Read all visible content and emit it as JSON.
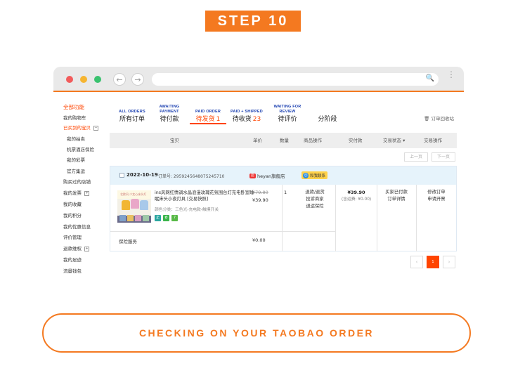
{
  "step_label": "STEP 10",
  "caption": "CHECKING ON YOUR TAOBAO ORDER",
  "browser": {
    "back_glyph": "←",
    "forward_glyph": "→",
    "search_glyph": "🔍",
    "menu_glyph": "⋮"
  },
  "sidebar": {
    "items": [
      {
        "label": "全部功能",
        "kind": "head"
      },
      {
        "label": "我的购物车",
        "kind": "item"
      },
      {
        "label": "已买到的宝贝",
        "kind": "active",
        "toggle": "−"
      },
      {
        "label": "我的拍卖",
        "kind": "sub"
      },
      {
        "label": "机票酒店保险",
        "kind": "sub"
      },
      {
        "label": "我的彩票",
        "kind": "sub"
      },
      {
        "label": "官方集运",
        "kind": "sub"
      },
      {
        "label": "购买过的店铺",
        "kind": "item"
      },
      {
        "label": "我的发票",
        "kind": "item",
        "toggle": "+"
      },
      {
        "label": "我的收藏",
        "kind": "item"
      },
      {
        "label": "我的积分",
        "kind": "item"
      },
      {
        "label": "我的优惠信息",
        "kind": "item"
      },
      {
        "label": "评价管理",
        "kind": "item"
      },
      {
        "label": "退款维权",
        "kind": "item",
        "toggle": "+"
      },
      {
        "label": "我的足迹",
        "kind": "item"
      },
      {
        "label": "流量钱包",
        "kind": "item"
      }
    ]
  },
  "tabs": [
    {
      "en": "ALL ORDERS",
      "cn": "所有订单",
      "count": ""
    },
    {
      "en": "AWAITING PAYMENT",
      "cn": "待付款",
      "count": ""
    },
    {
      "en": "PAID ORDER",
      "cn": "待发货",
      "count": "1",
      "active": true
    },
    {
      "en": "PAID + SHIPPED",
      "cn": "待收货",
      "count": "23"
    },
    {
      "en": "WAITING FOR REVIEW",
      "cn": "待评价",
      "count": ""
    },
    {
      "en": "",
      "cn": "分阶段",
      "count": ""
    }
  ],
  "recycle_bin": "🗑 订单回收站",
  "table_headers": [
    "宝贝",
    "单价",
    "数量",
    "商品操作",
    "实付款",
    "交易状态 ▾",
    "交易操作"
  ],
  "pager_top": {
    "prev": "上一页",
    "next": "下一页"
  },
  "order": {
    "date": "2022-10-19",
    "number": "订单号: 2959245648075245710",
    "shop": "heyan旗舰店",
    "contact": "和我联系",
    "thumb_title": "北欧风 少女心床头灯",
    "title": "ins风网红情调水晶浪漫玫瑰花氛围台灯充电卧室睡眠床头小夜灯具 [交易快照]",
    "spec": "颜色分类：三色光-充电款-触摸开关",
    "badges": [
      {
        "text": "正",
        "color": "#2aa6a0"
      },
      {
        "text": "✿",
        "color": "#3ab54a"
      },
      {
        "text": "7",
        "color": "#58b947"
      }
    ],
    "price_original": "¥79.80",
    "price_now": "¥39.90",
    "quantity": "1",
    "ops": [
      "退款/退货",
      "投诉商家",
      "退运保险"
    ],
    "paid_amount": "¥39.90",
    "paid_shipping": "(含运费: ¥0.00)",
    "status": [
      "买家已付款",
      "订单详情"
    ],
    "tx_ops": [
      "修改订单",
      "申请开票"
    ],
    "insurance_label": "保险服务",
    "insurance_price": "¥0.00"
  },
  "pagination": {
    "prev": "‹",
    "current": "1",
    "next": "›"
  },
  "colors": {
    "accent": "#f47920",
    "taobao_orange": "#ff4400",
    "tab_blue": "#1a3fb0"
  }
}
